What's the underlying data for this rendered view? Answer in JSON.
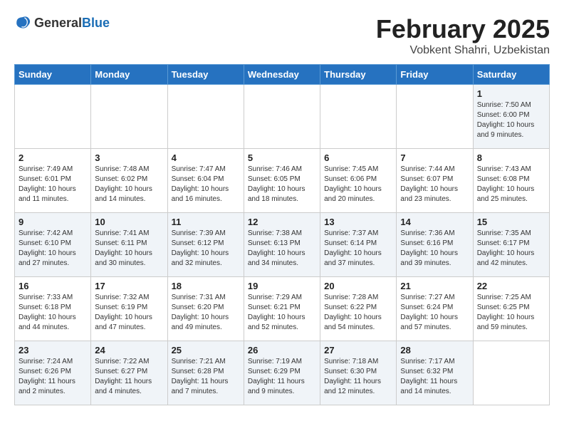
{
  "header": {
    "logo_general": "General",
    "logo_blue": "Blue",
    "title": "February 2025",
    "subtitle": "Vobkent Shahri, Uzbekistan"
  },
  "days_of_week": [
    "Sunday",
    "Monday",
    "Tuesday",
    "Wednesday",
    "Thursday",
    "Friday",
    "Saturday"
  ],
  "weeks": [
    [
      {
        "day": "",
        "info": ""
      },
      {
        "day": "",
        "info": ""
      },
      {
        "day": "",
        "info": ""
      },
      {
        "day": "",
        "info": ""
      },
      {
        "day": "",
        "info": ""
      },
      {
        "day": "",
        "info": ""
      },
      {
        "day": "1",
        "info": "Sunrise: 7:50 AM\nSunset: 6:00 PM\nDaylight: 10 hours\nand 9 minutes."
      }
    ],
    [
      {
        "day": "2",
        "info": "Sunrise: 7:49 AM\nSunset: 6:01 PM\nDaylight: 10 hours\nand 11 minutes."
      },
      {
        "day": "3",
        "info": "Sunrise: 7:48 AM\nSunset: 6:02 PM\nDaylight: 10 hours\nand 14 minutes."
      },
      {
        "day": "4",
        "info": "Sunrise: 7:47 AM\nSunset: 6:04 PM\nDaylight: 10 hours\nand 16 minutes."
      },
      {
        "day": "5",
        "info": "Sunrise: 7:46 AM\nSunset: 6:05 PM\nDaylight: 10 hours\nand 18 minutes."
      },
      {
        "day": "6",
        "info": "Sunrise: 7:45 AM\nSunset: 6:06 PM\nDaylight: 10 hours\nand 20 minutes."
      },
      {
        "day": "7",
        "info": "Sunrise: 7:44 AM\nSunset: 6:07 PM\nDaylight: 10 hours\nand 23 minutes."
      },
      {
        "day": "8",
        "info": "Sunrise: 7:43 AM\nSunset: 6:08 PM\nDaylight: 10 hours\nand 25 minutes."
      }
    ],
    [
      {
        "day": "9",
        "info": "Sunrise: 7:42 AM\nSunset: 6:10 PM\nDaylight: 10 hours\nand 27 minutes."
      },
      {
        "day": "10",
        "info": "Sunrise: 7:41 AM\nSunset: 6:11 PM\nDaylight: 10 hours\nand 30 minutes."
      },
      {
        "day": "11",
        "info": "Sunrise: 7:39 AM\nSunset: 6:12 PM\nDaylight: 10 hours\nand 32 minutes."
      },
      {
        "day": "12",
        "info": "Sunrise: 7:38 AM\nSunset: 6:13 PM\nDaylight: 10 hours\nand 34 minutes."
      },
      {
        "day": "13",
        "info": "Sunrise: 7:37 AM\nSunset: 6:14 PM\nDaylight: 10 hours\nand 37 minutes."
      },
      {
        "day": "14",
        "info": "Sunrise: 7:36 AM\nSunset: 6:16 PM\nDaylight: 10 hours\nand 39 minutes."
      },
      {
        "day": "15",
        "info": "Sunrise: 7:35 AM\nSunset: 6:17 PM\nDaylight: 10 hours\nand 42 minutes."
      }
    ],
    [
      {
        "day": "16",
        "info": "Sunrise: 7:33 AM\nSunset: 6:18 PM\nDaylight: 10 hours\nand 44 minutes."
      },
      {
        "day": "17",
        "info": "Sunrise: 7:32 AM\nSunset: 6:19 PM\nDaylight: 10 hours\nand 47 minutes."
      },
      {
        "day": "18",
        "info": "Sunrise: 7:31 AM\nSunset: 6:20 PM\nDaylight: 10 hours\nand 49 minutes."
      },
      {
        "day": "19",
        "info": "Sunrise: 7:29 AM\nSunset: 6:21 PM\nDaylight: 10 hours\nand 52 minutes."
      },
      {
        "day": "20",
        "info": "Sunrise: 7:28 AM\nSunset: 6:22 PM\nDaylight: 10 hours\nand 54 minutes."
      },
      {
        "day": "21",
        "info": "Sunrise: 7:27 AM\nSunset: 6:24 PM\nDaylight: 10 hours\nand 57 minutes."
      },
      {
        "day": "22",
        "info": "Sunrise: 7:25 AM\nSunset: 6:25 PM\nDaylight: 10 hours\nand 59 minutes."
      }
    ],
    [
      {
        "day": "23",
        "info": "Sunrise: 7:24 AM\nSunset: 6:26 PM\nDaylight: 11 hours\nand 2 minutes."
      },
      {
        "day": "24",
        "info": "Sunrise: 7:22 AM\nSunset: 6:27 PM\nDaylight: 11 hours\nand 4 minutes."
      },
      {
        "day": "25",
        "info": "Sunrise: 7:21 AM\nSunset: 6:28 PM\nDaylight: 11 hours\nand 7 minutes."
      },
      {
        "day": "26",
        "info": "Sunrise: 7:19 AM\nSunset: 6:29 PM\nDaylight: 11 hours\nand 9 minutes."
      },
      {
        "day": "27",
        "info": "Sunrise: 7:18 AM\nSunset: 6:30 PM\nDaylight: 11 hours\nand 12 minutes."
      },
      {
        "day": "28",
        "info": "Sunrise: 7:17 AM\nSunset: 6:32 PM\nDaylight: 11 hours\nand 14 minutes."
      },
      {
        "day": "",
        "info": ""
      }
    ]
  ]
}
